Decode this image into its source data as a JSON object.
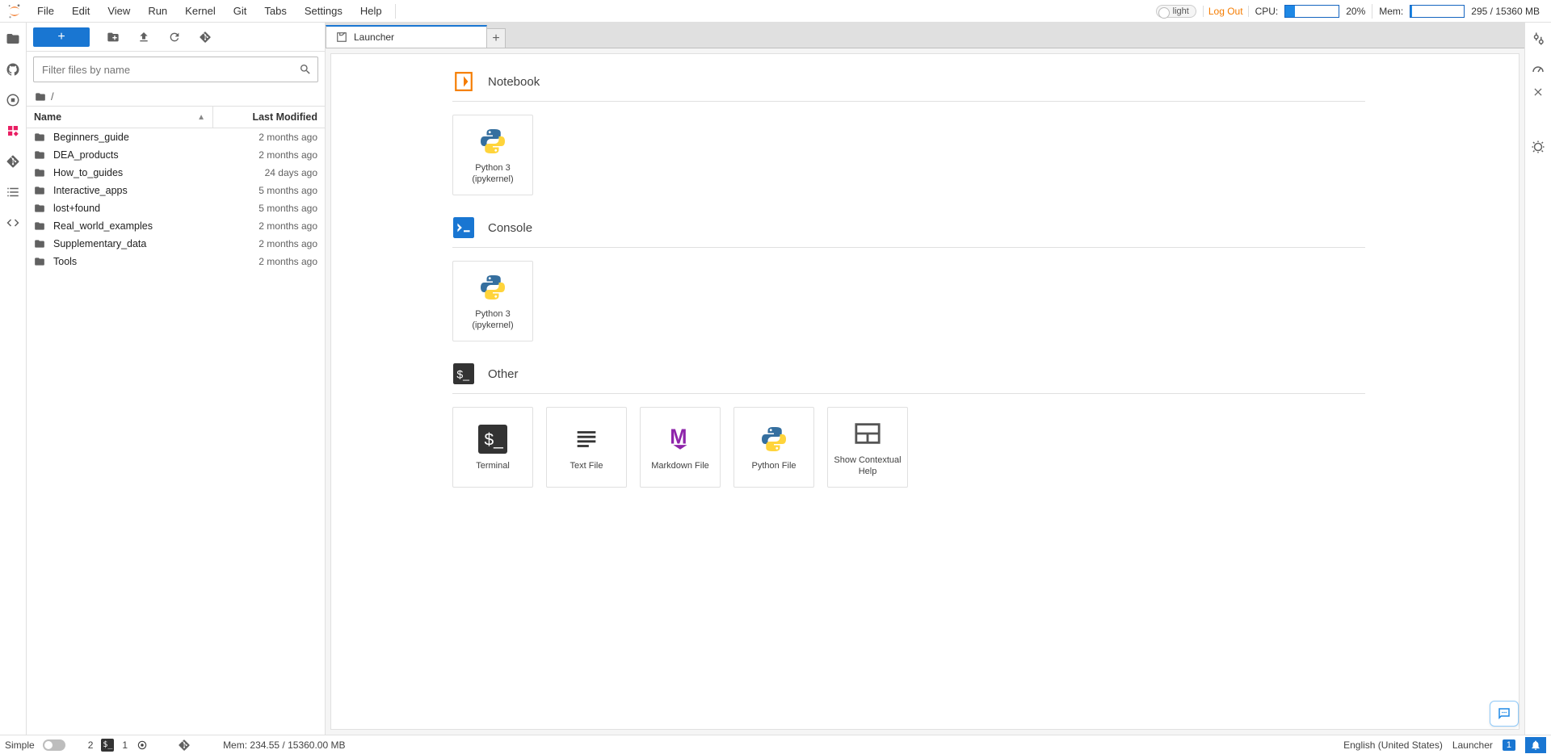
{
  "menubar": {
    "items": [
      "File",
      "Edit",
      "View",
      "Run",
      "Kernel",
      "Git",
      "Tabs",
      "Settings",
      "Help"
    ],
    "right": {
      "theme_label": "light",
      "logout_label": "Log Out",
      "cpu_label": "CPU:",
      "cpu_percent_text": "20%",
      "cpu_bar_fill_percent": 18,
      "mem_label": "Mem:",
      "mem_text": "295 / 15360 MB",
      "mem_bar_fill_percent": 2
    }
  },
  "activity_left": [
    "folder-icon",
    "github-icon",
    "circle-dot-icon",
    "box-icon",
    "git-icon",
    "list-icon",
    "code-icon"
  ],
  "activity_right": [
    "gear-icon",
    "gauge-icon",
    "close-icon",
    "bug-icon"
  ],
  "sidebar": {
    "filter_placeholder": "Filter files by name",
    "breadcrumb_slash": "/",
    "header_name": "Name",
    "header_modified": "Last Modified",
    "files": [
      {
        "name": "Beginners_guide",
        "modified": "2 months ago"
      },
      {
        "name": "DEA_products",
        "modified": "2 months ago"
      },
      {
        "name": "How_to_guides",
        "modified": "24 days ago"
      },
      {
        "name": "Interactive_apps",
        "modified": "5 months ago"
      },
      {
        "name": "lost+found",
        "modified": "5 months ago"
      },
      {
        "name": "Real_world_examples",
        "modified": "2 months ago"
      },
      {
        "name": "Supplementary_data",
        "modified": "2 months ago"
      },
      {
        "name": "Tools",
        "modified": "2 months ago"
      }
    ]
  },
  "tab": {
    "label": "Launcher"
  },
  "launcher": {
    "sections": {
      "notebook": {
        "title": "Notebook",
        "cards": [
          {
            "label": "Python 3 (ipykernel)"
          }
        ]
      },
      "console": {
        "title": "Console",
        "cards": [
          {
            "label": "Python 3 (ipykernel)"
          }
        ]
      },
      "other": {
        "title": "Other",
        "cards": [
          {
            "label": "Terminal"
          },
          {
            "label": "Text File"
          },
          {
            "label": "Markdown File"
          },
          {
            "label": "Python File"
          },
          {
            "label": "Show Contextual Help"
          }
        ]
      }
    }
  },
  "statusbar": {
    "simple_label": "Simple",
    "left_numbers": {
      "a": "2",
      "b": "1"
    },
    "mem_text": "Mem: 234.55 / 15360.00 MB",
    "lang": "English (United States)",
    "mode": "Launcher",
    "notif_count": "1"
  }
}
